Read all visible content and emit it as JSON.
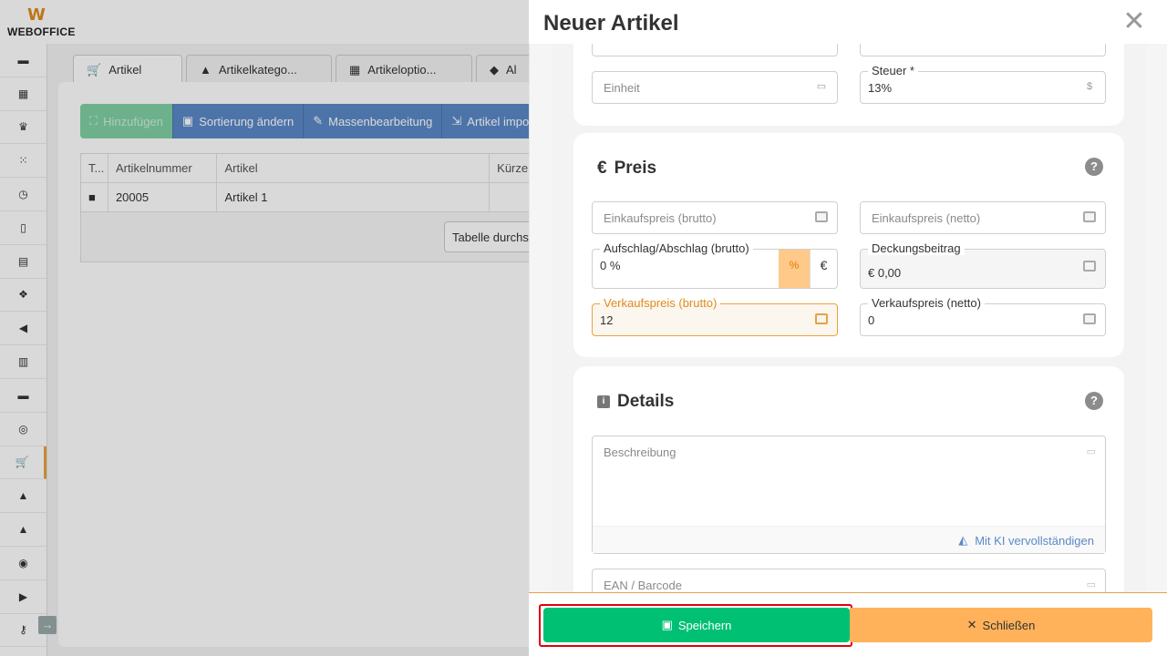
{
  "app": {
    "logo_text": "WEBOFFICE",
    "logo_mark": "W"
  },
  "sidebar": {
    "items": [
      {
        "icon": "briefcase-icon",
        "glyph": "▬"
      },
      {
        "icon": "calendar-icon",
        "glyph": "▦"
      },
      {
        "icon": "crown-icon",
        "glyph": "♛"
      },
      {
        "icon": "nodes-icon",
        "glyph": "⁙"
      },
      {
        "icon": "clock-icon",
        "glyph": "◷"
      },
      {
        "icon": "document-icon",
        "glyph": "▯"
      },
      {
        "icon": "list-icon",
        "glyph": "▤"
      },
      {
        "icon": "cubes-icon",
        "glyph": "❖"
      },
      {
        "icon": "megaphone-icon",
        "glyph": "◀"
      },
      {
        "icon": "chart-icon",
        "glyph": "▥"
      },
      {
        "icon": "folder-icon",
        "glyph": "▬"
      },
      {
        "icon": "database-icon",
        "glyph": "◎"
      },
      {
        "icon": "cart-icon",
        "glyph": "🛒"
      },
      {
        "icon": "warehouse-icon",
        "glyph": "▲"
      },
      {
        "icon": "area-chart-icon",
        "glyph": "▲"
      },
      {
        "icon": "users-icon",
        "glyph": "◉"
      },
      {
        "icon": "truck-icon",
        "glyph": "▶"
      },
      {
        "icon": "key-icon",
        "glyph": "⚷"
      }
    ],
    "active_index": 12,
    "collapse_glyph": "→"
  },
  "tabs": [
    {
      "label": "Artikel",
      "glyph": "🛒"
    },
    {
      "label": "Artikelkatego...",
      "glyph": "▲"
    },
    {
      "label": "Artikeloptio...",
      "glyph": "▦"
    },
    {
      "label": "Al",
      "glyph": "◆"
    }
  ],
  "toolbar": {
    "add": "Hinzufügen",
    "sort": "Sortierung ändern",
    "bulk": "Massenbearbeitung",
    "import": "Artikel impo"
  },
  "table": {
    "headers": [
      "T...",
      "Artikelnummer",
      "Artikel",
      "Kürze"
    ],
    "rows": [
      {
        "type_glyph": "■",
        "number": "20005",
        "name": "Artikel 1",
        "short": ""
      }
    ],
    "scroll_button": "Tabelle durchsu"
  },
  "drawer": {
    "title": "Neuer Artikel",
    "close_glyph": "✕",
    "basic": {
      "unit_placeholder": "Einheit",
      "tax_label": "Steuer *",
      "tax_value": "13%"
    },
    "price": {
      "heading": "Preis",
      "heading_glyph": "€",
      "help": "?",
      "purchase_gross_placeholder": "Einkaufspreis (brutto)",
      "purchase_net_placeholder": "Einkaufspreis (netto)",
      "markup_label": "Aufschlag/Abschlag (brutto)",
      "markup_value": "0 %",
      "markup_pct": "%",
      "markup_eur": "€",
      "margin_label": "Deckungsbeitrag",
      "margin_value": "€ 0,00",
      "sale_gross_label": "Verkaufspreis (brutto)",
      "sale_gross_value": "12",
      "sale_net_label": "Verkaufspreis (netto)",
      "sale_net_value": "0"
    },
    "details": {
      "heading": "Details",
      "heading_glyph": "i",
      "help": "?",
      "description_placeholder": "Beschreibung",
      "ai_complete": "Mit KI vervollständigen",
      "ean_placeholder": "EAN / Barcode"
    },
    "footer": {
      "save": "Speichern",
      "close": "Schließen"
    }
  },
  "colors": {
    "save": "#00c074",
    "close": "#ffb25a",
    "accent": "#e8a33d",
    "link": "#5b89c7",
    "highlight": "#e0000f"
  }
}
